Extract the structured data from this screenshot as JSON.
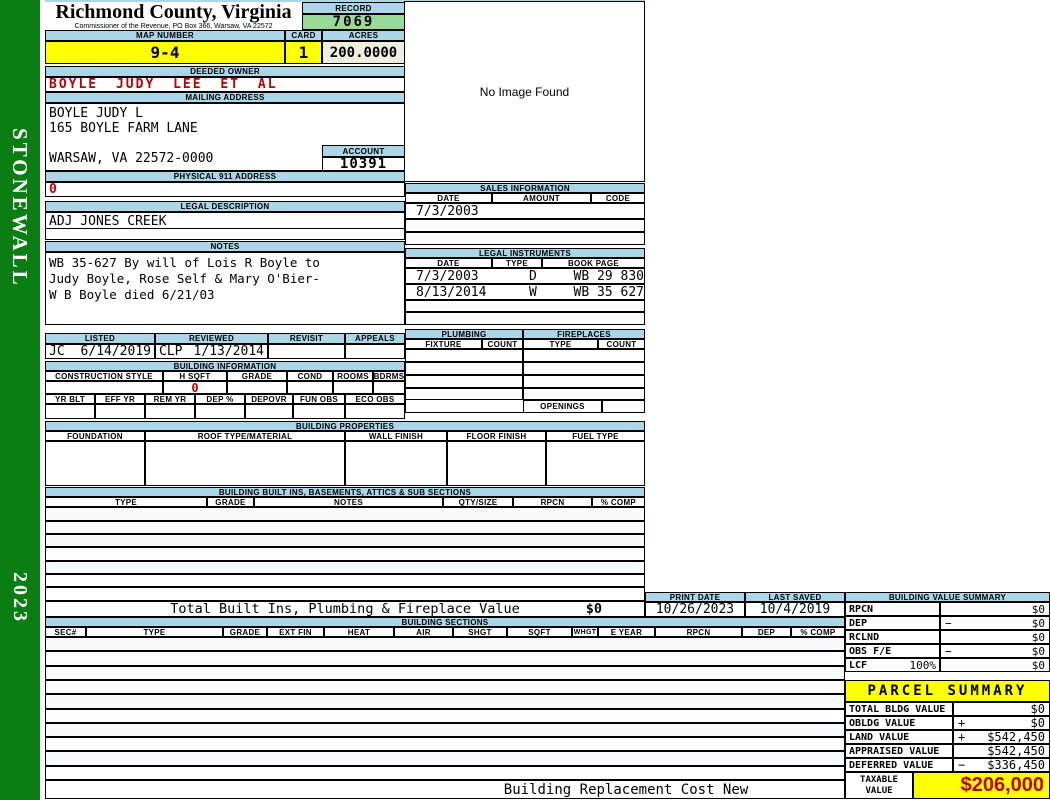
{
  "colors": {
    "header_blue": "#abd6e7",
    "highlight_yellow": "#ffff00",
    "sidebar_green": "#0a7e12",
    "record_green": "#98db98",
    "acres_beige": "#eeeedd",
    "alert_red": "#c00000"
  },
  "sidebar": {
    "district": "STONEWALL",
    "year": "2023"
  },
  "header": {
    "county": "Richmond County, Virginia",
    "office": "Commissioner of the Revenue, PO Box 366, Warsaw, VA 22572",
    "record_label": "RECORD",
    "record_value": "7069",
    "map_number_label": "MAP NUMBER",
    "map_number": "9-4",
    "card_label": "CARD",
    "card": "1",
    "acres_label": "ACRES",
    "acres": "200.0000"
  },
  "image_panel": {
    "message": "No Image Found"
  },
  "owner": {
    "deeded_owner_label": "DEEDED OWNER",
    "deeded_owner": "BOYLE JUDY LEE ET AL",
    "mailing_address_label": "MAILING ADDRESS",
    "mailing_lines": [
      "BOYLE JUDY L",
      "165 BOYLE FARM LANE",
      "",
      "WARSAW, VA 22572-0000"
    ],
    "account_label": "ACCOUNT",
    "account": "10391",
    "physical_address_label": "PHYSICAL 911 ADDRESS",
    "physical_address": "0",
    "legal_description_label": "LEGAL DESCRIPTION",
    "legal_description": "ADJ JONES CREEK",
    "notes_label": "NOTES",
    "notes_lines": [
      "WB 35-627 By will of Lois R Boyle to",
      "Judy Boyle, Rose Self & Mary O'Bier-",
      "W B Boyle died 6/21/03"
    ]
  },
  "review": {
    "headers": [
      "LISTED",
      "REVIEWED",
      "REVISIT",
      "APPEALS"
    ],
    "listed_by": "JC",
    "listed_date": "6/14/2019",
    "reviewed_by": "CLP",
    "reviewed_date": "1/13/2014",
    "revisit": "",
    "appeals": ""
  },
  "sales": {
    "title": "SALES INFORMATION",
    "headers": [
      "DATE",
      "AMOUNT",
      "CODE"
    ],
    "rows": [
      {
        "date": "7/3/2003",
        "amount": "",
        "code": ""
      }
    ]
  },
  "legal_instruments": {
    "title": "LEGAL INSTRUMENTS",
    "headers": [
      "DATE",
      "TYPE",
      "BOOK PAGE"
    ],
    "rows": [
      {
        "date": "7/3/2003",
        "type": "D",
        "book_page": "WB 29 830"
      },
      {
        "date": "8/13/2014",
        "type": "W",
        "book_page": "WB 35 627"
      }
    ]
  },
  "plumbing": {
    "title": "PLUMBING",
    "headers": [
      "FIXTURE",
      "COUNT"
    ]
  },
  "fireplaces": {
    "title": "FIREPLACES",
    "headers": [
      "TYPE",
      "COUNT"
    ],
    "openings_label": "OPENINGS"
  },
  "building_information": {
    "title": "BUILDING INFORMATION",
    "row1_headers": [
      "CONSTRUCTION STYLE",
      "H SQFT",
      "GRADE",
      "COND",
      "ROOMS",
      "BDRMS"
    ],
    "h_sqft": "0",
    "row2_headers": [
      "YR BLT",
      "EFF YR",
      "REM YR",
      "DEP %",
      "DEPOVR",
      "FUN OBS",
      "ECO OBS"
    ]
  },
  "building_properties": {
    "title": "BUILDING PROPERTIES",
    "headers": [
      "FOUNDATION",
      "ROOF TYPE/MATERIAL",
      "WALL FINISH",
      "FLOOR FINISH",
      "FUEL TYPE"
    ]
  },
  "built_ins": {
    "title": "BUILDING BUILT INS, BASEMENTS, ATTICS & SUB SECTIONS",
    "headers": [
      "TYPE",
      "GRADE",
      "NOTES",
      "QTY/SIZE",
      "RPCN",
      "% COMP"
    ],
    "total_label": "Total Built Ins, Plumbing & Fireplace Value",
    "total_value": "$0"
  },
  "building_sections": {
    "title": "BUILDING SECTIONS",
    "headers": [
      "SEC#",
      "TYPE",
      "GRADE",
      "EXT FIN",
      "HEAT",
      "AIR",
      "SHGT",
      "SQFT",
      "WHGT",
      "E YEAR",
      "RPCN",
      "DEP",
      "% COMP"
    ],
    "footer_label": "Building Replacement Cost New"
  },
  "print_info": {
    "print_date_label": "PRINT DATE",
    "print_date": "10/26/2023",
    "last_saved_label": "LAST SAVED",
    "last_saved": "10/4/2019"
  },
  "building_value_summary": {
    "title": "BUILDING VALUE SUMMARY",
    "rows": [
      {
        "label": "RPCN",
        "op": "",
        "value": "$0"
      },
      {
        "label": "DEP",
        "op": "−",
        "value": "$0"
      },
      {
        "label": "RCLND",
        "op": "",
        "value": "$0"
      },
      {
        "label": "OBS F/E",
        "op": "−",
        "value": "$0"
      },
      {
        "label": "LCF",
        "pct": "100%",
        "op": "",
        "value": "$0"
      }
    ]
  },
  "parcel_summary": {
    "title": "PARCEL SUMMARY",
    "rows": [
      {
        "label": "TOTAL BLDG VALUE",
        "op": "",
        "value": "$0"
      },
      {
        "label": "OBLDG VALUE",
        "op": "+",
        "value": "$0"
      },
      {
        "label": "LAND VALUE",
        "op": "+",
        "value": "$542,450"
      },
      {
        "label": "APPRAISED VALUE",
        "op": "",
        "value": "$542,450"
      },
      {
        "label": "DEFERRED VALUE",
        "op": "−",
        "value": "$336,450"
      }
    ],
    "taxable_label": "TAXABLE VALUE",
    "taxable_value": "$206,000"
  }
}
